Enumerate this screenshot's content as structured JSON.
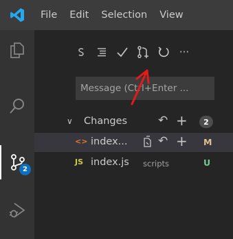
{
  "menu": [
    "File",
    "Edit",
    "Selection",
    "View"
  ],
  "activity_bar": {
    "icons": [
      "files-icon",
      "search-icon",
      "source-control-icon",
      "run-debug-icon"
    ],
    "scm_badge": "2"
  },
  "scm": {
    "toolbar_icons": [
      "view-as-tree-icon",
      "list-icon",
      "commit-check-icon",
      "pull-request-icon",
      "refresh-icon",
      "more-icon"
    ],
    "toolbar_more": "···",
    "message_placeholder": "Message (Ctrl+Enter ..."
  },
  "changes": {
    "label": "Changes",
    "chevron": "∨",
    "discard_glyph": "↶",
    "stage_glyph": "+",
    "count": "2",
    "files": [
      {
        "icon": "<>",
        "icon_color": "#e37933",
        "name": "index...",
        "description": "",
        "status": "M",
        "status_color": "#e2c08d"
      },
      {
        "icon": "JS",
        "icon_color": "#cbcb41",
        "name": "index.js",
        "description": "scripts",
        "status": "U",
        "status_color": "#73c991"
      }
    ]
  },
  "colors": {
    "activity_bar": "#333333",
    "sidebar": "#252526",
    "titlebar": "#3c3c3c",
    "badge_blue": "#0e70c0",
    "annotation_arrow": "#e51b1b"
  }
}
